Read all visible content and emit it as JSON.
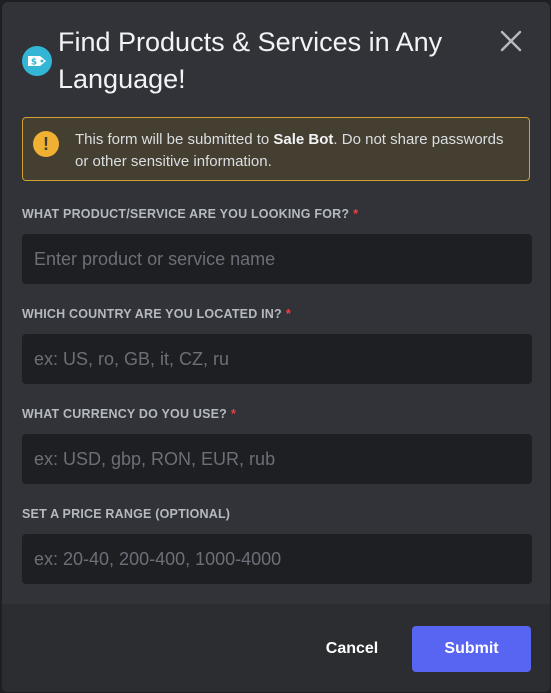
{
  "modal": {
    "title": "Find Products & Services in Any Language!",
    "bot_icon": "price-tag-icon",
    "close_icon": "close-icon"
  },
  "warning": {
    "icon": "warning-icon",
    "text_before": "This form will be submitted to ",
    "bot_name": "Sale Bot",
    "text_after": ". Do not share passwords or other sensitive information."
  },
  "fields": [
    {
      "label": "WHAT PRODUCT/SERVICE ARE YOU LOOKING FOR?",
      "required_marker": "*",
      "value": "",
      "placeholder": "Enter product or service name"
    },
    {
      "label": "WHICH COUNTRY ARE YOU LOCATED IN?",
      "required_marker": "*",
      "value": "",
      "placeholder": "ex: US, ro, GB, it, CZ, ru"
    },
    {
      "label": "WHAT CURRENCY DO YOU USE?",
      "required_marker": "*",
      "value": "",
      "placeholder": "ex: USD, gbp, RON, EUR, rub"
    },
    {
      "label": "SET A PRICE RANGE (OPTIONAL)",
      "required_marker": "",
      "value": "",
      "placeholder": "ex: 20-40, 200-400, 1000-4000"
    }
  ],
  "footer": {
    "cancel_label": "Cancel",
    "submit_label": "Submit"
  },
  "colors": {
    "accent": "#5865f2",
    "warning_border": "#d1a232",
    "warning_icon": "#f0b132",
    "required": "#f23f43",
    "bot_icon_bg": "#33b5d6"
  }
}
